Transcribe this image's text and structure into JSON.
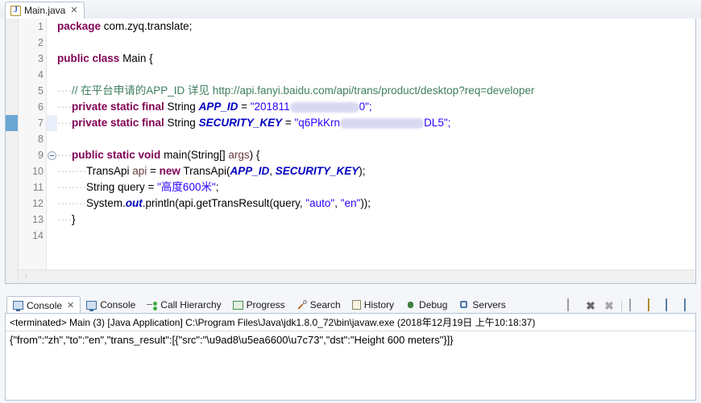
{
  "editor": {
    "tab": {
      "title": "Main.java",
      "close": "✕",
      "icon": "java-file-icon"
    },
    "line_numbers": [
      "1",
      "2",
      "3",
      "4",
      "5",
      "6",
      "7",
      "8",
      "9",
      "10",
      "11",
      "12",
      "13",
      "14"
    ],
    "current_line": 7,
    "fold_line": 9,
    "changed_line": 7,
    "scroll_arrow": "‹",
    "code": {
      "l1_kw": "package",
      "l1_rest": " com.zyq.translate;",
      "l3_kw1": "public",
      "l3_kw2": "class",
      "l3_rest": " Main {",
      "l5_comment": "// 在平台申请的APP_ID 详见 http://api.fanyi.baidu.com/api/trans/product/desktop?req=developer",
      "l6_kw": "private static final",
      "l6_type": " String ",
      "l6_field": "APP_ID",
      "l6_eq": " = ",
      "l6_str_start": "\"201811",
      "l6_str_end": "0\";",
      "l7_kw": "private static final",
      "l7_type": " String ",
      "l7_field": "SECURITY_KEY",
      "l7_eq": " = ",
      "l7_str_start": "\"q6PkKrn",
      "l7_str_end": "DL5\";",
      "l9_kw1": "public",
      "l9_kw2": "static",
      "l9_kw3": "void",
      "l9_name": " main(String[] ",
      "l9_param": "args",
      "l9_tail": ") {",
      "l10_a": "TransApi ",
      "l10_api": "api",
      "l10_eq": " = ",
      "l10_new": "new",
      "l10_ctor": " TransApi(",
      "l10_f1": "APP_ID",
      "l10_comma": ", ",
      "l10_f2": "SECURITY_KEY",
      "l10_tail": ");",
      "l11_a": "String query = ",
      "l11_str": "\"高度600米\"",
      "l11_tail": ";",
      "l12_a": "System.",
      "l12_out": "out",
      "l12_b": ".println(api.getTransResult(query, ",
      "l12_s1": "\"auto\"",
      "l12_c": ", ",
      "l12_s2": "\"en\"",
      "l12_tail": "));",
      "l13": "}"
    }
  },
  "console": {
    "tabs": [
      {
        "label": "Console",
        "icon": "console-icon",
        "active": true,
        "close": "✕"
      },
      {
        "label": "Console",
        "icon": "console-icon",
        "active": false
      },
      {
        "label": "Call Hierarchy",
        "icon": "call-hierarchy-icon",
        "active": false
      },
      {
        "label": "Progress",
        "icon": "progress-icon",
        "active": false
      },
      {
        "label": "Search",
        "icon": "search-icon",
        "active": false
      },
      {
        "label": "History",
        "icon": "history-icon",
        "active": false
      },
      {
        "label": "Debug",
        "icon": "debug-icon",
        "active": false
      },
      {
        "label": "Servers",
        "icon": "servers-icon",
        "active": false
      }
    ],
    "toolbar": [
      {
        "name": "terminate-button",
        "icon": "stop-icon"
      },
      {
        "name": "remove-launch-button",
        "icon": "x-icon"
      },
      {
        "name": "remove-all-terminated-button",
        "icon": "xx-icon"
      },
      {
        "name": "clear-console-button",
        "icon": "clear-page-icon"
      },
      {
        "name": "scroll-lock-button",
        "icon": "lock-icon"
      },
      {
        "name": "pin-console-button",
        "icon": "screen-icon"
      },
      {
        "name": "display-selected-console-button",
        "icon": "screen-x-icon"
      }
    ],
    "status": "<terminated> Main (3) [Java Application] C:\\Program Files\\Java\\jdk1.8.0_72\\bin\\javaw.exe (2018年12月19日 上午10:18:37)",
    "output": "{\"from\":\"zh\",\"to\":\"en\",\"trans_result\":[{\"src\":\"\\u9ad8\\u5ea6600\\u7c73\",\"dst\":\"Height 600 meters\"}]}"
  },
  "colors": {
    "keyword": "#7f0055",
    "string": "#2a00ff",
    "comment": "#3f7f5f",
    "field": "#0000c0",
    "parameter": "#6a3e3e",
    "current_line_highlight": "#e9f0fb",
    "border": "#b6c3d3"
  }
}
